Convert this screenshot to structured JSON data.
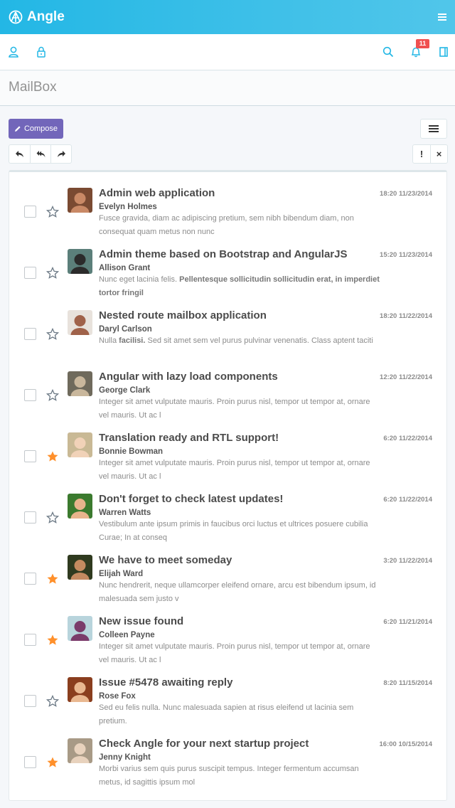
{
  "app": {
    "brand": "Angle",
    "page_title": "MailBox",
    "notification_count": "11",
    "accent_color": "#23b7e5",
    "compose_color": "#7266ba",
    "star_active_color": "#ff902b"
  },
  "toolbar": {
    "compose_label": "Compose",
    "left_actions": [
      "reply-icon",
      "reply-all-icon",
      "forward-icon"
    ],
    "right_actions": [
      "!",
      "×"
    ]
  },
  "icons": {
    "topbar": [
      "angle-logo-icon",
      "menu-icon"
    ],
    "subbar_left": [
      "user-icon",
      "lock-icon"
    ],
    "subbar_right": [
      "search-icon",
      "bell-icon",
      "sidebar-toggle-icon"
    ]
  },
  "mails": [
    {
      "subject": "Admin web application",
      "sender": "Evelyn Holmes",
      "time": "18:20 11/23/2014",
      "starred": false,
      "preview": [
        {
          "t": "Fusce gravida, diam ac adipiscing pretium, sem nibh bibendum diam, non consequat quam metus non nunc",
          "b": false
        }
      ],
      "avatar_bg": "#7a4a32",
      "avatar_fg": "#c98966"
    },
    {
      "subject": "Admin theme based on Bootstrap and AngularJS",
      "sender": "Allison Grant",
      "time": "15:20 11/23/2014",
      "starred": false,
      "preview": [
        {
          "t": "Nunc eget lacinia felis. ",
          "b": false
        },
        {
          "t": "Pellentesque sollicitudin sollicitudin erat, in imperdiet tortor fringil",
          "b": true
        }
      ],
      "avatar_bg": "#5b7f7a",
      "avatar_fg": "#2b2b2b"
    },
    {
      "subject": "Nested route mailbox application",
      "sender": "Daryl Carlson",
      "time": "18:20 11/22/2014",
      "starred": false,
      "preview": [
        {
          "t": "Nulla ",
          "b": false
        },
        {
          "t": "facilisi.",
          "b": true
        },
        {
          "t": " Sed sit amet sem vel purus pulvinar venenatis. Class aptent taciti",
          "b": false
        }
      ],
      "avatar_bg": "#e8e2dc",
      "avatar_fg": "#a0624a"
    },
    {
      "subject": "Angular with lazy load components",
      "sender": "George Clark",
      "time": "12:20 11/22/2014",
      "starred": false,
      "preview": [
        {
          "t": "Integer sit amet vulputate mauris. Proin purus nisl, tempor ut tempor at, ornare vel mauris. Ut ac l",
          "b": false
        }
      ],
      "avatar_bg": "#6f6a5c",
      "avatar_fg": "#c9b79c"
    },
    {
      "subject": "Translation ready and RTL support!",
      "sender": "Bonnie Bowman",
      "time": "6:20 11/22/2014",
      "starred": true,
      "preview": [
        {
          "t": "Integer sit amet vulputate mauris. Proin purus nisl, tempor ut tempor at, ornare vel mauris. Ut ac l",
          "b": false
        }
      ],
      "avatar_bg": "#c9b995",
      "avatar_fg": "#f1d2b8"
    },
    {
      "subject": "Don't forget to check latest updates!",
      "sender": "Warren Watts",
      "time": "6:20 11/22/2014",
      "starred": false,
      "preview": [
        {
          "t": "Vestibulum ante ipsum primis in faucibus orci luctus et ultrices posuere cubilia Curae; In at conseq",
          "b": false
        }
      ],
      "avatar_bg": "#3b7a2e",
      "avatar_fg": "#e8b48c"
    },
    {
      "subject": "We have to meet someday",
      "sender": "Elijah Ward",
      "time": "3:20 11/22/2014",
      "starred": true,
      "preview": [
        {
          "t": "Nunc hendrerit, neque ullamcorper eleifend ornare, arcu est bibendum ipsum, id malesuada sem justo v",
          "b": false
        }
      ],
      "avatar_bg": "#2f3a1f",
      "avatar_fg": "#c48a60"
    },
    {
      "subject": "New issue found",
      "sender": "Colleen Payne",
      "time": "6:20 11/21/2014",
      "starred": true,
      "preview": [
        {
          "t": "Integer sit amet vulputate mauris. Proin purus nisl, tempor ut tempor at, ornare vel mauris. Ut ac l",
          "b": false
        }
      ],
      "avatar_bg": "#b8d4dc",
      "avatar_fg": "#7a3a6a"
    },
    {
      "subject": "Issue #5478 awaiting reply",
      "sender": "Rose Fox",
      "time": "8:20 11/15/2014",
      "starred": false,
      "preview": [
        {
          "t": "Sed eu felis nulla. Nunc malesuada sapien at risus eleifend ut lacinia sem pretium.",
          "b": false
        }
      ],
      "avatar_bg": "#8a3e1e",
      "avatar_fg": "#e9b891"
    },
    {
      "subject": "Check Angle for your next startup project",
      "sender": "Jenny Knight",
      "time": "16:00 10/15/2014",
      "starred": true,
      "preview": [
        {
          "t": "Morbi varius sem quis purus suscipit tempus. Integer fermentum accumsan metus, id sagittis ipsum mol",
          "b": false
        }
      ],
      "avatar_bg": "#a89a86",
      "avatar_fg": "#e8d2bd"
    }
  ]
}
